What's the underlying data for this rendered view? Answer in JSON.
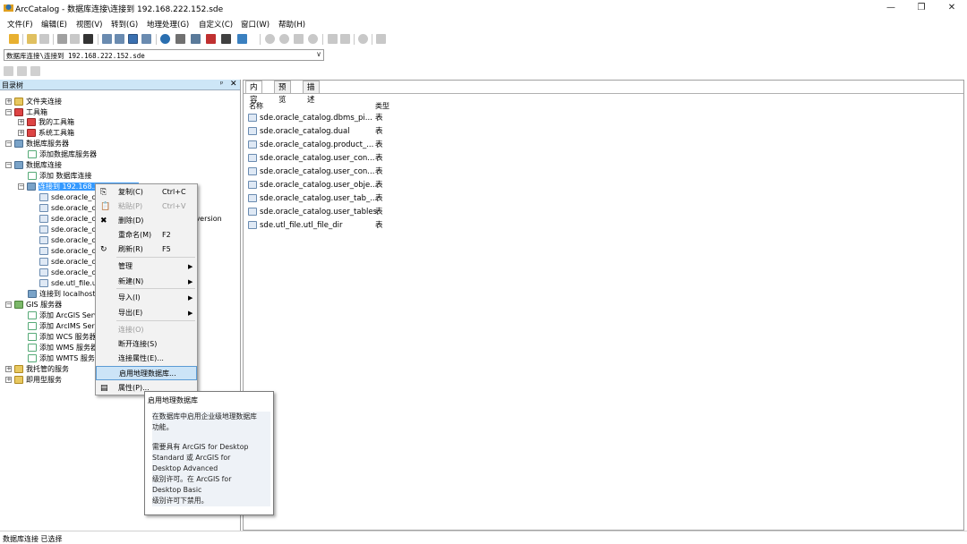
{
  "window": {
    "title": "ArcCatalog - 数据库连接\\连接到 192.168.222.152.sde",
    "minimize": "—",
    "restore": "❐",
    "close": "✕"
  },
  "menu": [
    "文件(F)",
    "编辑(E)",
    "视图(V)",
    "转到(G)",
    "地理处理(G)",
    "自定义(C)",
    "窗口(W)",
    "帮助(H)"
  ],
  "location": {
    "value": "数据库连接\\连接到 192.168.222.152.sde",
    "dropdown": "∨"
  },
  "catalog_tree": {
    "header": "目录树",
    "pin": "ᵖ",
    "close": "✕",
    "items": [
      {
        "label": "文件夹连接",
        "exp": "+"
      },
      {
        "label": "工具箱",
        "exp": "−"
      },
      {
        "label": "我的工具箱",
        "exp": "+"
      },
      {
        "label": "系统工具箱",
        "exp": "+"
      },
      {
        "label": "数据库服务器",
        "exp": "−"
      },
      {
        "label": "添加数据库服务器",
        "exp": ""
      },
      {
        "label": "数据库连接",
        "exp": "−"
      },
      {
        "label": "添加 数据库连接",
        "exp": ""
      },
      {
        "label": "连接到 192.168.222.152.sde",
        "exp": "−"
      },
      {
        "label": "sde.oracle_catalog.dbms_pipe",
        "exp": ""
      },
      {
        "label": "sde.oracle_catalog.dual",
        "exp": ""
      },
      {
        "label": "sde.oracle_catalog.product_component_version",
        "exp": ""
      },
      {
        "label": "sde.oracle_catalog.user_cons_columns",
        "exp": ""
      },
      {
        "label": "sde.oracle_catalog.user_constraints",
        "exp": ""
      },
      {
        "label": "sde.oracle_catalog.user_objects",
        "exp": ""
      },
      {
        "label": "sde.oracle_catalog.user_tab_columns",
        "exp": ""
      },
      {
        "label": "sde.oracle_catalog.user_tables",
        "exp": ""
      },
      {
        "label": "sde.utl_file.utl_file_dir",
        "exp": ""
      },
      {
        "label": "连接到 localhost.sde",
        "exp": ""
      },
      {
        "label": "GIS 服务器",
        "exp": "−"
      },
      {
        "label": "添加 ArcGIS Server",
        "exp": ""
      },
      {
        "label": "添加 ArcIMS Server",
        "exp": ""
      },
      {
        "label": "添加 WCS 服务器",
        "exp": ""
      },
      {
        "label": "添加 WMS 服务器",
        "exp": ""
      },
      {
        "label": "添加 WMTS 服务器",
        "exp": ""
      },
      {
        "label": "我托管的服务",
        "exp": "+"
      },
      {
        "label": "即用型服务",
        "exp": "+"
      }
    ]
  },
  "tabs": [
    "内容",
    "预览",
    "描述"
  ],
  "contents": {
    "col_name": "名称",
    "col_type": "类型",
    "rows": [
      {
        "name": "sde.oracle_catalog.dbms_pi...",
        "type": "表"
      },
      {
        "name": "sde.oracle_catalog.dual",
        "type": "表"
      },
      {
        "name": "sde.oracle_catalog.product_...",
        "type": "表"
      },
      {
        "name": "sde.oracle_catalog.user_con...",
        "type": "表"
      },
      {
        "name": "sde.oracle_catalog.user_con...",
        "type": "表"
      },
      {
        "name": "sde.oracle_catalog.user_obje...",
        "type": "表"
      },
      {
        "name": "sde.oracle_catalog.user_tab_...",
        "type": "表"
      },
      {
        "name": "sde.oracle_catalog.user_tables",
        "type": "表"
      },
      {
        "name": "sde.utl_file.utl_file_dir",
        "type": "表"
      }
    ]
  },
  "context_menu": {
    "items": [
      {
        "label": "复制(C)",
        "shortcut": "Ctrl+C",
        "icon": "copy-icon",
        "glyph": "⎘",
        "disabled": false,
        "submenu": false
      },
      {
        "label": "粘贴(P)",
        "shortcut": "Ctrl+V",
        "icon": "paste-icon",
        "glyph": "📋",
        "disabled": true,
        "submenu": false
      },
      {
        "label": "删除(D)",
        "shortcut": "",
        "icon": "delete-icon",
        "glyph": "✖",
        "disabled": false,
        "submenu": false
      },
      {
        "label": "重命名(M)",
        "shortcut": "F2",
        "icon": "",
        "glyph": "",
        "disabled": false,
        "submenu": false
      },
      {
        "label": "刷新(R)",
        "shortcut": "F5",
        "icon": "refresh-icon",
        "glyph": "↻",
        "disabled": false,
        "submenu": false
      },
      {
        "label": "管理",
        "shortcut": "",
        "icon": "",
        "glyph": "",
        "disabled": false,
        "submenu": true
      },
      {
        "label": "新建(N)",
        "shortcut": "",
        "icon": "",
        "glyph": "",
        "disabled": false,
        "submenu": true
      },
      {
        "label": "导入(I)",
        "shortcut": "",
        "icon": "",
        "glyph": "",
        "disabled": false,
        "submenu": true
      },
      {
        "label": "导出(E)",
        "shortcut": "",
        "icon": "",
        "glyph": "",
        "disabled": false,
        "submenu": true
      },
      {
        "label": "连接(O)",
        "shortcut": "",
        "icon": "",
        "glyph": "",
        "disabled": true,
        "submenu": false
      },
      {
        "label": "断开连接(S)",
        "shortcut": "",
        "icon": "",
        "glyph": "",
        "disabled": false,
        "submenu": false
      },
      {
        "label": "连接属性(E)...",
        "shortcut": "",
        "icon": "",
        "glyph": "",
        "disabled": false,
        "submenu": false
      },
      {
        "label": "启用地理数据库...",
        "shortcut": "",
        "icon": "",
        "glyph": "",
        "disabled": false,
        "submenu": false,
        "highlighted": true
      },
      {
        "label": "属性(P)...",
        "shortcut": "",
        "icon": "properties-icon",
        "glyph": "▤",
        "disabled": false,
        "submenu": false
      }
    ],
    "submenu_arrow": "▶"
  },
  "tooltip": {
    "title": "启用地理数据库",
    "line1": "在数据库中启用企业级地理数据库",
    "line2": "功能。",
    "line3": "需要具有 ArcGIS for Desktop",
    "line4": "Standard 或 ArcGIS for",
    "line5": "Desktop Advanced",
    "line6": "级别许可。在 ArcGIS for",
    "line7": "Desktop Basic",
    "line8": "级别许可下禁用。"
  },
  "status": "数据库连接 已选择",
  "colors": {
    "accent": "#3399ff",
    "highlight": "#cce4f7"
  }
}
